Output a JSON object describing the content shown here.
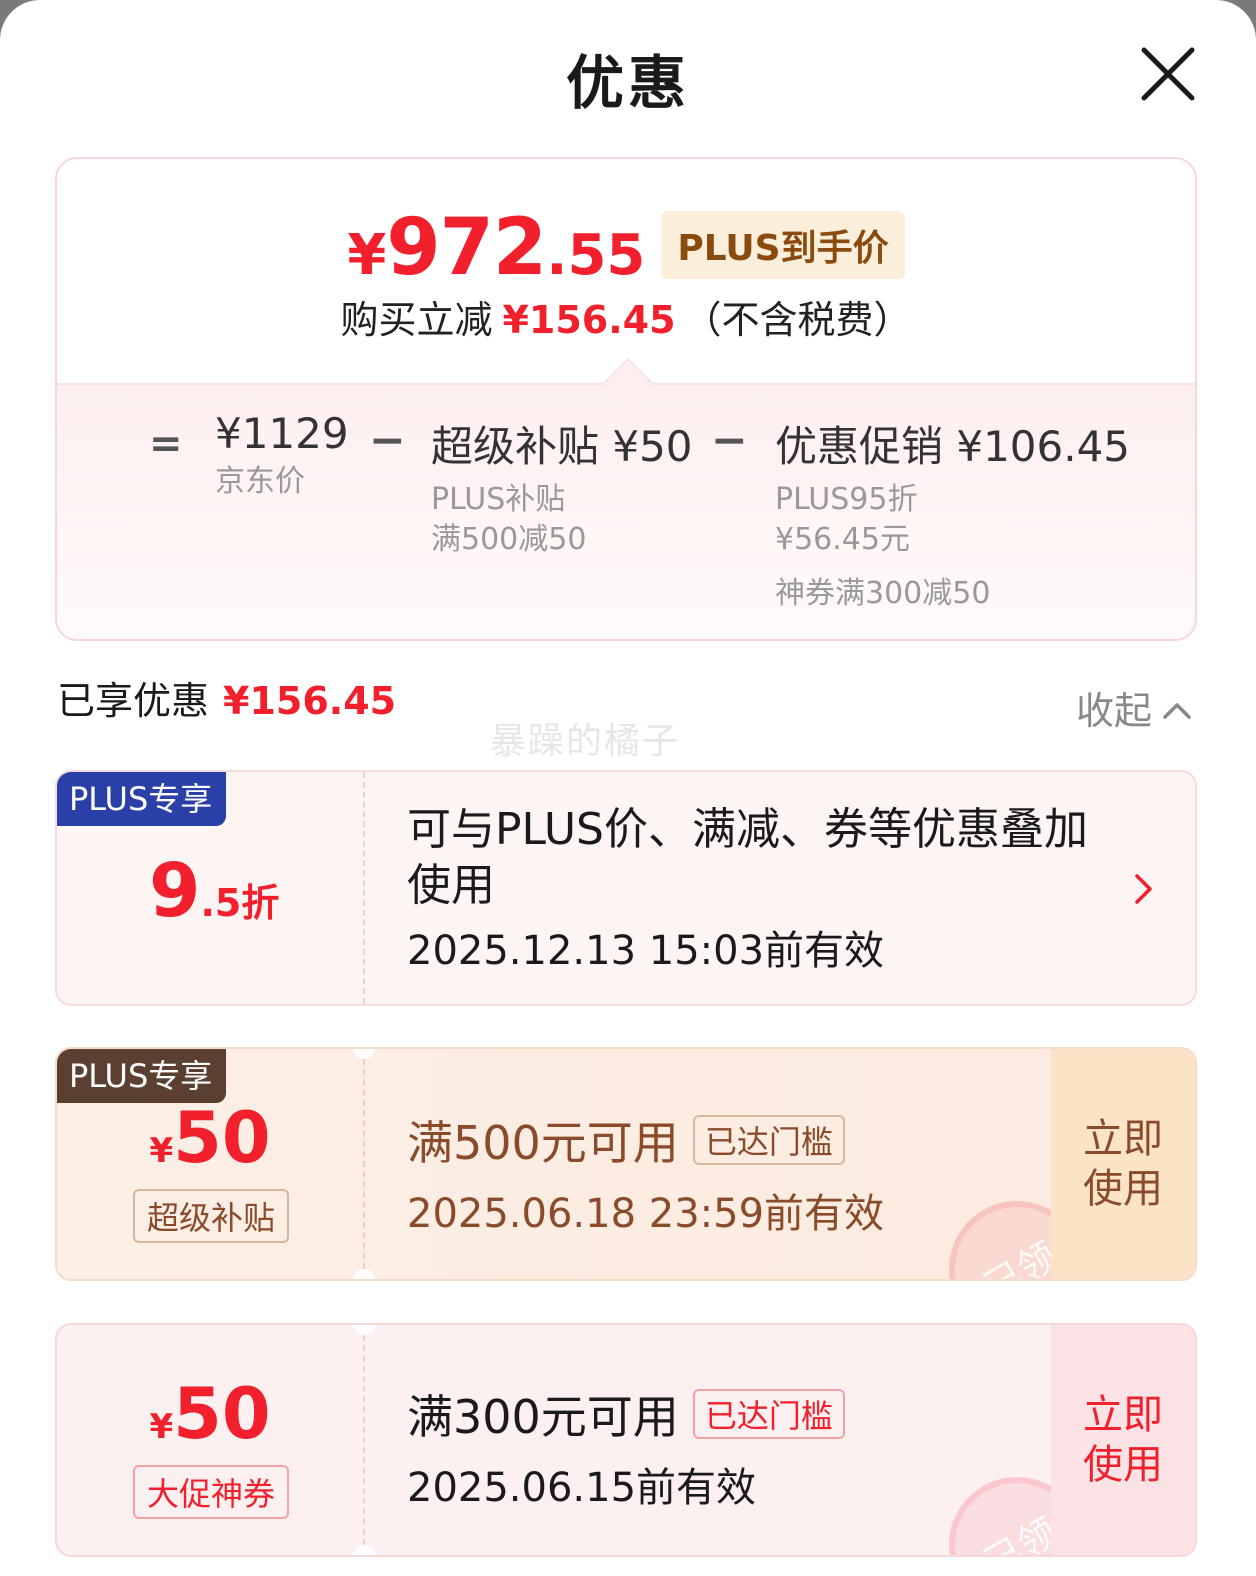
{
  "header": {
    "title": "优惠"
  },
  "summary": {
    "price_symbol": "¥",
    "price_int": "972",
    "price_dec": ".55",
    "price_badge": "PLUS到手价",
    "reduce_prefix": "购买立减",
    "reduce_amount": "¥156.45",
    "reduce_suffix": "（不含税费）",
    "equals": "=",
    "minus": "−",
    "jd_price": {
      "amount": "¥1129",
      "label": "京东价"
    },
    "subsidy": {
      "title": "超级补贴 ¥50",
      "lines": [
        "PLUS补贴",
        "满500减50"
      ]
    },
    "promo": {
      "title": "优惠促销 ¥106.45",
      "lines": [
        "PLUS95折",
        "¥56.45元",
        "神券满300减50"
      ]
    }
  },
  "enjoyed": {
    "label": "已享优惠",
    "amount": "¥156.45",
    "collapse_label": "收起"
  },
  "watermark": "暴躁的橘子",
  "coupons": [
    {
      "tag": "PLUS专享",
      "discount_big": "9",
      "discount_small": ".5折",
      "description": "可与PLUS价、满减、券等优惠叠加使用",
      "date": "2025.12.13 15:03前有效"
    },
    {
      "tag": "PLUS专享",
      "symbol": "¥",
      "amount": "50",
      "label": "超级补贴",
      "title": "满500元可用",
      "threshold": "已达门槛",
      "date": "2025.06.18 23:59前有效",
      "action": "立即使用",
      "stamp": "已领"
    },
    {
      "symbol": "¥",
      "amount": "50",
      "label": "大促神券",
      "title": "满300元可用",
      "threshold": "已达门槛",
      "date": "2025.06.15前有效",
      "action": "立即使用",
      "stamp": "已领"
    }
  ],
  "colors": {
    "accent_red": "#f2202c",
    "plus_blue": "#2b3fa8",
    "plus_brown": "#5b4032",
    "badge_gold": "#8a4b0f"
  },
  "icons": {
    "close": "close-icon",
    "collapse": "chevron-up-icon",
    "detail": "chevron-right-icon"
  }
}
